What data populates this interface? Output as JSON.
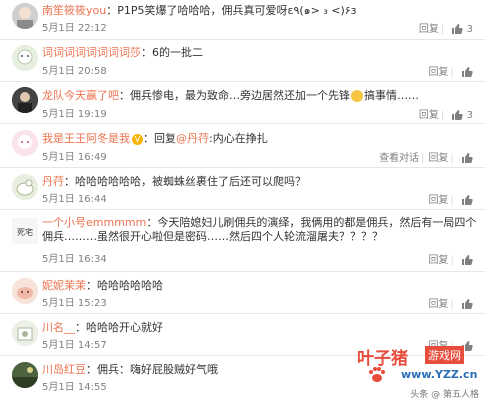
{
  "labels": {
    "reply": "回复",
    "view_conversation": "查看对话"
  },
  "comments": [
    {
      "user": "南笙筱筱you",
      "text": "P1P5笑爆了哈哈哈，佣兵真可爱呀ε٩(๑> ₃ <)۶з",
      "time": "5月1日 22:12",
      "likes": "3"
    },
    {
      "user": "词词词词词词词词莎",
      "text": "6的一批二",
      "time": "5月1日 20:58"
    },
    {
      "user": "龙队今天赢了吧",
      "text_before": "佣兵惨电，最为致命…旁边居然还加一个先锋",
      "text_after": "搞事情……",
      "time": "5月1日 19:19",
      "likes": "3"
    },
    {
      "user": "我是王王阿冬是我",
      "reply_prefix": "回复",
      "mention": "@丹荇",
      "text": "内心在挣扎",
      "time": "5月1日 16:49"
    },
    {
      "user": "丹荇",
      "text": "哈哈哈哈哈哈，被蜘蛛丝裹住了后还可以爬吗？",
      "time": "5月1日 16:44"
    },
    {
      "user": "一个小号emmmmm",
      "text": "今天陪媳妇儿刷佣兵的演绎，我俩用的都是佣兵，然后有一局四个佣兵………虽然很开心啦但是密码……然后四个人轮流溜屠夫？？？？",
      "time": "5月1日 16:34",
      "avatar_text": "死宅"
    },
    {
      "user": "妮妮茉茉",
      "text": "哈哈哈哈哈哈",
      "time": "5月1日 15:23"
    },
    {
      "user": "川名__",
      "text": "哈哈哈开心就好",
      "time": "5月1日 14:57"
    },
    {
      "user": "川岛红豆",
      "text": "佣兵：嗨好屁股贼好气哦",
      "time": "5月1日 14:55"
    }
  ],
  "watermark": {
    "name": "叶子猪",
    "badge": "游戏网",
    "url": "www.YZZ.cn"
  },
  "footer_mark": "头条 @ 第五人格"
}
